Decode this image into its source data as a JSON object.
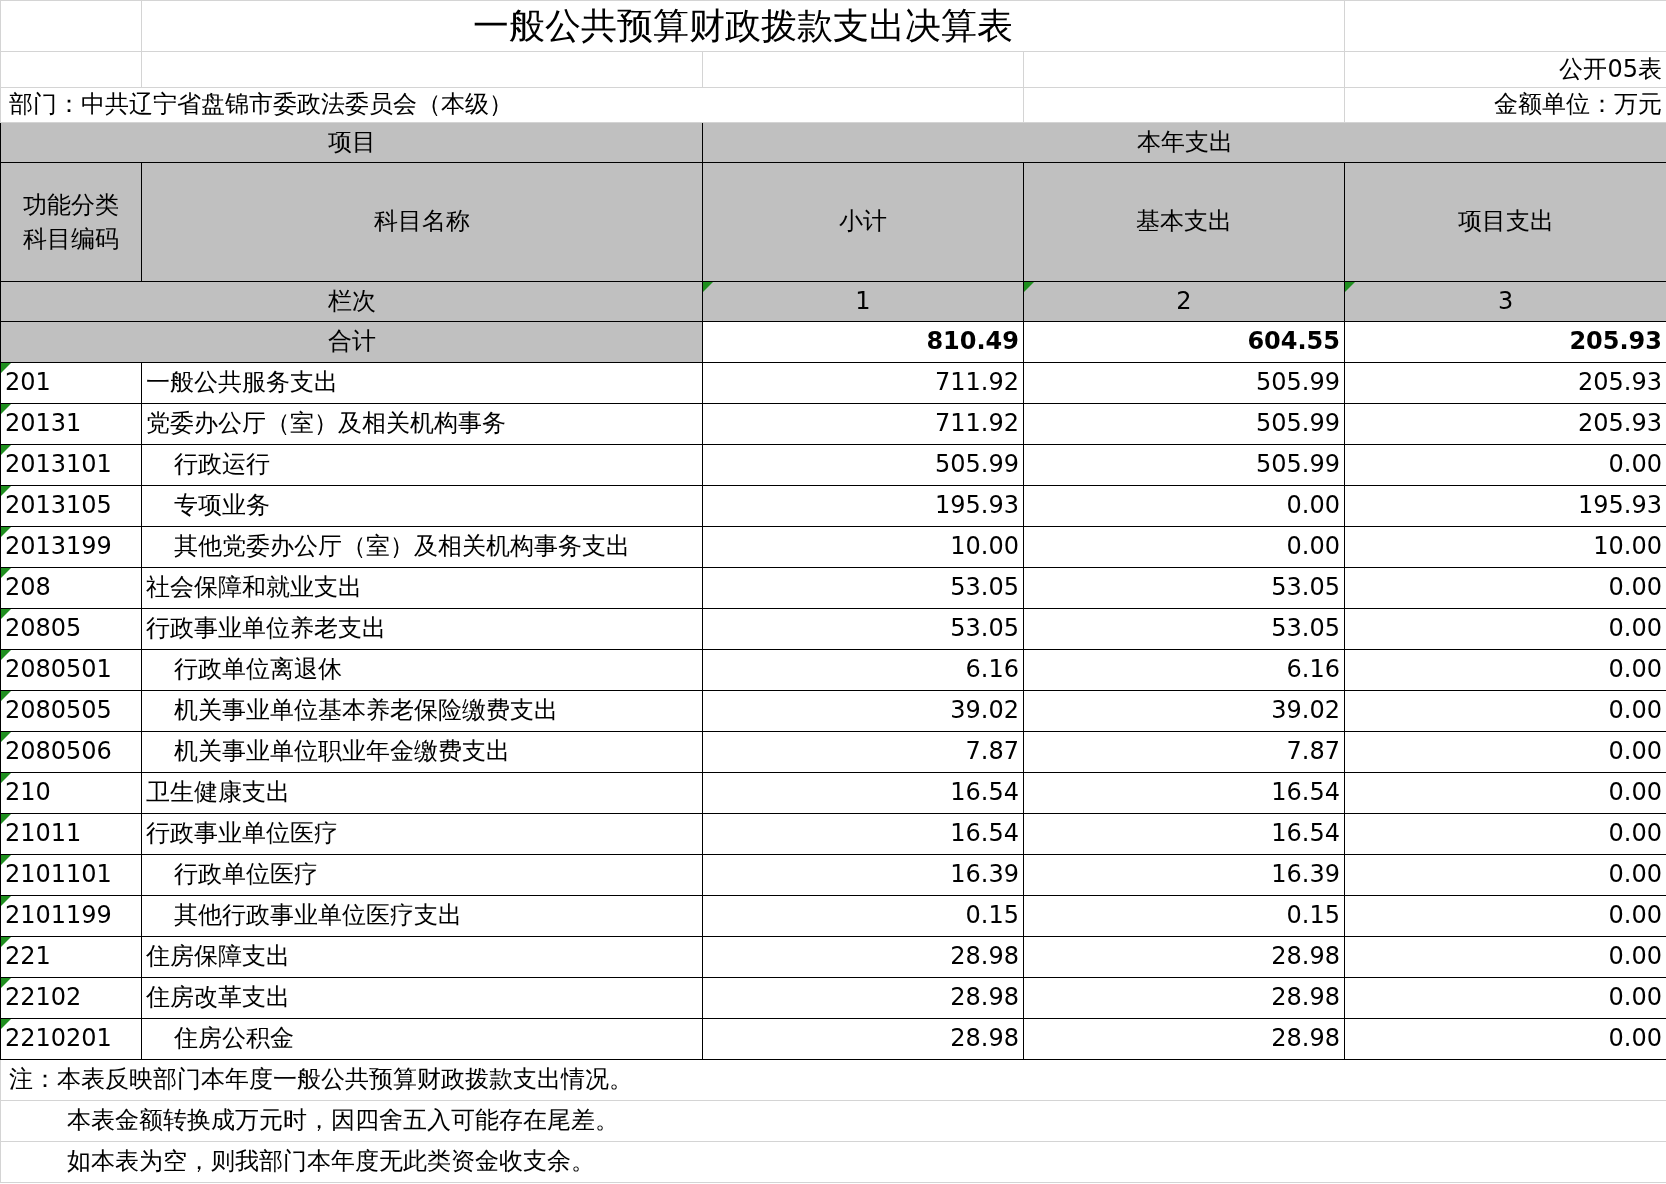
{
  "title": "一般公共预算财政拨款支出决算表",
  "table_no": "公开05表",
  "department": "部门：中共辽宁省盘锦市委政法委员会（本级）",
  "unit": "金额单位：万元",
  "header": {
    "group_left": "项目",
    "group_right": "本年支出",
    "code": "功能分类科目编码",
    "name": "科目名称",
    "columns": [
      "小计",
      "基本支出",
      "项目支出"
    ],
    "row_index_label": "栏次",
    "row_index": [
      "1",
      "2",
      "3"
    ]
  },
  "total": {
    "label": "合计",
    "values": [
      "810.49",
      "604.55",
      "205.93"
    ]
  },
  "rows": [
    {
      "code": "201",
      "name": "一般公共服务支出",
      "values": [
        "711.92",
        "505.99",
        "205.93"
      ],
      "children": [
        {
          "code": "20131",
          "name": "党委办公厅（室）及相关机构事务",
          "values": [
            "711.92",
            "505.99",
            "205.93"
          ],
          "children": [
            {
              "code": "2013101",
              "name": "行政运行",
              "values": [
                "505.99",
                "505.99",
                "0.00"
              ]
            },
            {
              "code": "2013105",
              "name": "专项业务",
              "values": [
                "195.93",
                "0.00",
                "195.93"
              ]
            },
            {
              "code": "2013199",
              "name": "其他党委办公厅（室）及相关机构事务支出",
              "values": [
                "10.00",
                "0.00",
                "10.00"
              ]
            }
          ]
        }
      ]
    },
    {
      "code": "208",
      "name": "社会保障和就业支出",
      "values": [
        "53.05",
        "53.05",
        "0.00"
      ],
      "children": [
        {
          "code": "20805",
          "name": "行政事业单位养老支出",
          "values": [
            "53.05",
            "53.05",
            "0.00"
          ],
          "children": [
            {
              "code": "2080501",
              "name": "行政单位离退休",
              "values": [
                "6.16",
                "6.16",
                "0.00"
              ]
            },
            {
              "code": "2080505",
              "name": "机关事业单位基本养老保险缴费支出",
              "values": [
                "39.02",
                "39.02",
                "0.00"
              ]
            },
            {
              "code": "2080506",
              "name": "机关事业单位职业年金缴费支出",
              "values": [
                "7.87",
                "7.87",
                "0.00"
              ]
            }
          ]
        }
      ]
    },
    {
      "code": "210",
      "name": "卫生健康支出",
      "values": [
        "16.54",
        "16.54",
        "0.00"
      ],
      "children": [
        {
          "code": "21011",
          "name": "行政事业单位医疗",
          "values": [
            "16.54",
            "16.54",
            "0.00"
          ],
          "children": [
            {
              "code": "2101101",
              "name": "行政单位医疗",
              "values": [
                "16.39",
                "16.39",
                "0.00"
              ]
            },
            {
              "code": "2101199",
              "name": "其他行政事业单位医疗支出",
              "values": [
                "0.15",
                "0.15",
                "0.00"
              ]
            }
          ]
        }
      ]
    },
    {
      "code": "221",
      "name": "住房保障支出",
      "values": [
        "28.98",
        "28.98",
        "0.00"
      ],
      "children": [
        {
          "code": "22102",
          "name": "住房改革支出",
          "values": [
            "28.98",
            "28.98",
            "0.00"
          ],
          "children": [
            {
              "code": "2210201",
              "name": "住房公积金",
              "values": [
                "28.98",
                "28.98",
                "0.00"
              ]
            }
          ]
        }
      ]
    }
  ],
  "notes": [
    "注：本表反映部门本年度一般公共预算财政拨款支出情况。",
    "本表金额转换成万元时，因四舍五入可能存在尾差。",
    "如本表为空，则我部门本年度无此类资金收支余。"
  ]
}
